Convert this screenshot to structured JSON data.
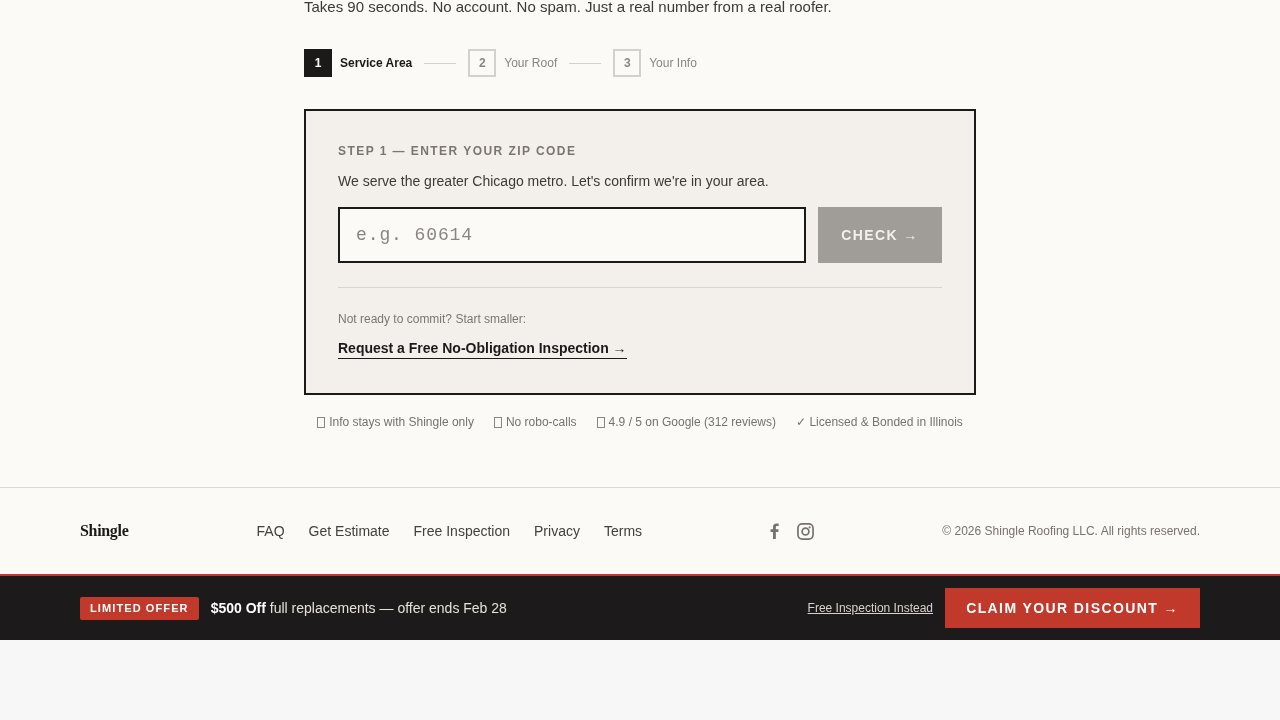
{
  "intro": "Takes 90 seconds. No account. No spam. Just a real number from a real roofer.",
  "steps": [
    {
      "number": "1",
      "label": "Service Area",
      "selected": true
    },
    {
      "number": "2",
      "label": "Your Roof",
      "selected": false
    },
    {
      "number": "3",
      "label": "Your Info",
      "selected": false
    }
  ],
  "card": {
    "heading": "STEP 1 — ENTER YOUR ZIP CODE",
    "description": "We serve the greater Chicago metro. Let's confirm we're in your area.",
    "zip_field": {
      "placeholder": "e.g. 60614"
    },
    "check_button": {
      "label": "CHECK →",
      "disabled": true
    },
    "alt_prompt": "Not ready to commit? Start smaller:",
    "alt_link": "Request a Free No-Obligation Inspection →"
  },
  "trust_items": [
    {
      "kind": "glyph",
      "text": "Info stays with Shingle only"
    },
    {
      "kind": "glyph",
      "text": "No robo-calls"
    },
    {
      "kind": "glyph",
      "text": "4.9 / 5 on Google (312 reviews)"
    },
    {
      "kind": "plain",
      "text": "✓ Licensed & Bonded in Illinois"
    }
  ],
  "footer": {
    "logo": "Shingle",
    "links": [
      "FAQ",
      "Get Estimate",
      "Free Inspection",
      "Privacy",
      "Terms"
    ],
    "copyright": "© 2026 Shingle Roofing LLC. All rights reserved."
  },
  "offer_bar": {
    "badge": "LIMITED OFFER",
    "message": "**$500 Off** full replacements — offer ends Feb 28",
    "secondary_link": "Free Inspection Instead",
    "cta": "CLAIM YOUR DISCOUNT →"
  }
}
